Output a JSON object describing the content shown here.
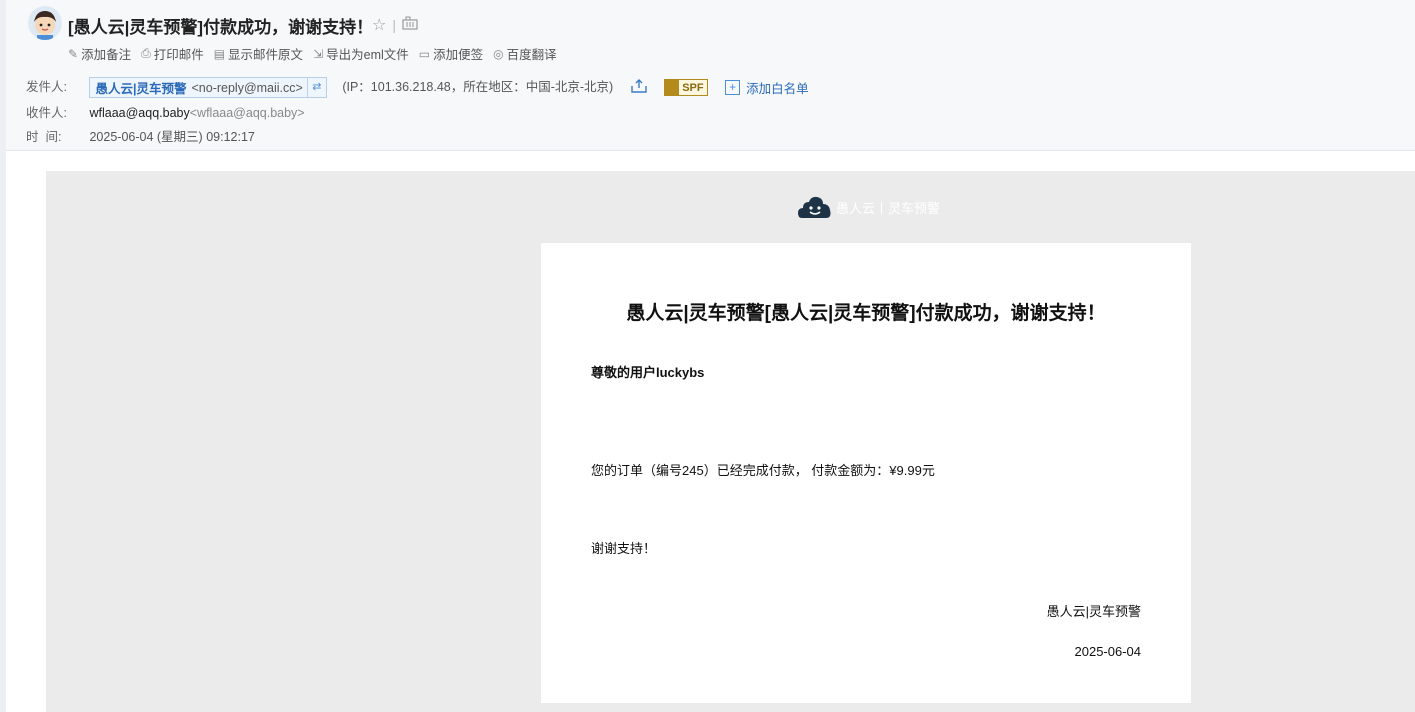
{
  "header": {
    "subject": "[愚人云|灵车预警]付款成功，谢谢支持！",
    "actions": [
      {
        "label": "添加备注",
        "icon": "pencil-icon"
      },
      {
        "label": "打印邮件",
        "icon": "printer-icon"
      },
      {
        "label": "显示邮件原文",
        "icon": "source-code-icon"
      },
      {
        "label": "导出为eml文件",
        "icon": "export-icon"
      },
      {
        "label": "添加便签",
        "icon": "note-icon"
      },
      {
        "label": "百度翻译",
        "icon": "translate-icon"
      }
    ],
    "from_label": "发件人:",
    "from_name": "愚人云|灵车预警",
    "from_addr": "<no-reply@maii.cc>",
    "ip_info": "(IP：101.36.218.48，所在地区：中国-北京-北京)",
    "spf": "SPF",
    "whitelist": "添加白名单",
    "to_label": "收件人:",
    "to_name": "wflaaa@aqq.baby",
    "to_addr": "<wflaaa@aqq.baby>",
    "time_label": "时  间:",
    "time_value": "2025-06-04 (星期三) 09:12:17"
  },
  "mail": {
    "brand": "愚人云丨灵车预警",
    "title": "愚人云|灵车预警[愚人云|灵车预警]付款成功，谢谢支持！",
    "greeting": "尊敬的用户luckybs",
    "paragraph": "您的订单（编号245）已经完成付款， 付款金额为：¥9.99元",
    "thanks": "谢谢支持！",
    "signature": "愚人云|灵车预警",
    "date": "2025-06-04"
  },
  "colors": {
    "accent": "#2a6ab8",
    "mail_bg": "#ebebeb",
    "spf": "#b38a1c"
  }
}
